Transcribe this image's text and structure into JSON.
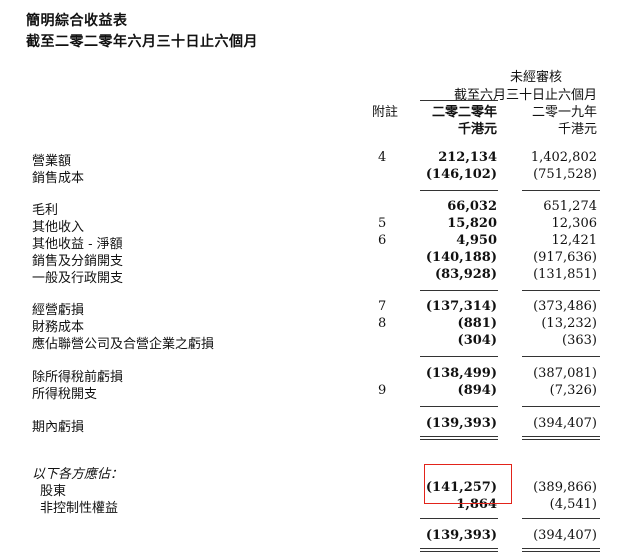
{
  "title": {
    "line1": "簡明綜合收益表",
    "line2": "截至二零二零年六月三十日止六個月"
  },
  "header": {
    "unaudited": "未經審核",
    "period": "截至六月三十日止六個月",
    "note_col": "附註",
    "year1": "二零二零年",
    "year2": "二零一九年",
    "unit1": "千港元",
    "unit2": "千港元"
  },
  "rows": [
    {
      "label": "營業額",
      "note": "4",
      "v2020": "212,134",
      "v2019": "1,402,802"
    },
    {
      "label": "銷售成本",
      "note": "",
      "v2020": "(146,102)",
      "v2019": "(751,528)"
    },
    {
      "label": "毛利",
      "note": "",
      "v2020": "66,032",
      "v2019": "651,274"
    },
    {
      "label": "其他收入",
      "note": "5",
      "v2020": "15,820",
      "v2019": "12,306"
    },
    {
      "label": "其他收益 - 淨額",
      "note": "6",
      "v2020": "4,950",
      "v2019": "12,421"
    },
    {
      "label": "銷售及分銷開支",
      "note": "",
      "v2020": "(140,188)",
      "v2019": "(917,636)"
    },
    {
      "label": "一般及行政開支",
      "note": "",
      "v2020": "(83,928)",
      "v2019": "(131,851)"
    },
    {
      "label": "經營虧損",
      "note": "7",
      "v2020": "(137,314)",
      "v2019": "(373,486)"
    },
    {
      "label": "財務成本",
      "note": "8",
      "v2020": "(881)",
      "v2019": "(13,232)"
    },
    {
      "label": "應佔聯營公司及合營企業之虧損",
      "note": "",
      "v2020": "(304)",
      "v2019": "(363)"
    },
    {
      "label": "除所得稅前虧損",
      "note": "",
      "v2020": "(138,499)",
      "v2019": "(387,081)"
    },
    {
      "label": "所得稅開支",
      "note": "9",
      "v2020": "(894)",
      "v2019": "(7,326)"
    },
    {
      "label": "期內虧損",
      "note": "",
      "v2020": "(139,393)",
      "v2019": "(394,407)"
    }
  ],
  "attributable": {
    "heading": "以下各方應佔：",
    "rows": [
      {
        "label": "股東",
        "v2020": "(141,257)",
        "v2019": "(389,866)"
      },
      {
        "label": "非控制性權益",
        "v2020": "1,864",
        "v2019": "(4,541)"
      }
    ],
    "total": {
      "v2020": "(139,393)",
      "v2019": "(394,407)"
    }
  },
  "highlight_color": "#e2231a"
}
